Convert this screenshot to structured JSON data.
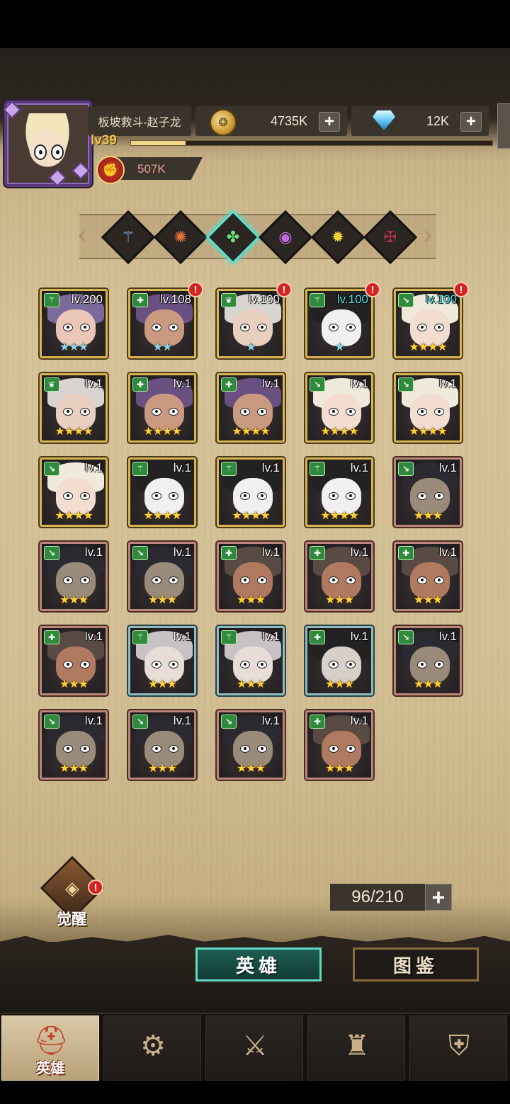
{
  "player": {
    "name": "板坡救斗-赵子龙",
    "level": "lv39",
    "level_progress": 0.15,
    "power": "507K"
  },
  "resources": {
    "gold": "4735K",
    "gems": "12K",
    "plus": "+"
  },
  "factions": [
    {
      "icon": "staff-faction-icon",
      "glyph": "⚚",
      "color": "#8fb8f0"
    },
    {
      "icon": "sun-faction-icon",
      "glyph": "✺",
      "color": "#e8743c"
    },
    {
      "icon": "clover-faction-icon",
      "glyph": "✤",
      "color": "#6be07a",
      "selected": true
    },
    {
      "icon": "eye-faction-icon",
      "glyph": "◉",
      "color": "#c66ae0"
    },
    {
      "icon": "radiant-faction-icon",
      "glyph": "✹",
      "color": "#f4d13a"
    },
    {
      "icon": "dark-faction-icon",
      "glyph": "✠",
      "color": "#b0304a"
    }
  ],
  "heroes": [
    {
      "level": "lv.200",
      "stars": "★★★",
      "star_color": "blue",
      "rarity": "legend",
      "cls": "⚚",
      "alert": false,
      "skin": "#e9c6b8",
      "hair": "#7b6a9a"
    },
    {
      "level": "lv.108",
      "stars": "★★",
      "star_color": "blue",
      "rarity": "legend",
      "cls": "✚",
      "alert": true,
      "skin": "#c99a80",
      "hair": "#6a5080"
    },
    {
      "level": "lv.100",
      "stars": "★",
      "star_color": "blue",
      "rarity": "legend",
      "cls": "❦",
      "alert": true,
      "skin": "#e8cfc0",
      "hair": "#d8d4d0"
    },
    {
      "level": "lv.100",
      "stars": "★",
      "star_color": "blue",
      "rarity": "legend",
      "cls": "⚚",
      "alert": true,
      "skin": "#f0f0f0",
      "hair": "#222",
      "level_color": "cyan"
    },
    {
      "level": "lv.100",
      "stars": "★★★★",
      "star_color": "gold",
      "rarity": "legend",
      "cls": "↘",
      "alert": true,
      "skin": "#f2ddd0",
      "hair": "#f0eadd",
      "level_color": "cyan"
    },
    {
      "level": "lv.1",
      "stars": "★★★★",
      "star_color": "gold",
      "rarity": "legend",
      "cls": "❦",
      "alert": false,
      "skin": "#e8cfc0",
      "hair": "#d8d4d0"
    },
    {
      "level": "lv.1",
      "stars": "★★★★",
      "star_color": "gold",
      "rarity": "legend",
      "cls": "✚",
      "alert": false,
      "skin": "#c99a80",
      "hair": "#6a5080"
    },
    {
      "level": "lv.1",
      "stars": "★★★★",
      "star_color": "gold",
      "rarity": "legend",
      "cls": "✚",
      "alert": false,
      "skin": "#c99a80",
      "hair": "#6a5080"
    },
    {
      "level": "lv.1",
      "stars": "★★★★",
      "star_color": "gold",
      "rarity": "legend",
      "cls": "↘",
      "alert": false,
      "skin": "#f2ddd0",
      "hair": "#f0eadd"
    },
    {
      "level": "lv.1",
      "stars": "★★★★",
      "star_color": "gold",
      "rarity": "legend",
      "cls": "↘",
      "alert": false,
      "skin": "#f2ddd0",
      "hair": "#f0eadd"
    },
    {
      "level": "lv.1",
      "stars": "★★★★",
      "star_color": "gold",
      "rarity": "legend",
      "cls": "↘",
      "alert": false,
      "skin": "#f2ddd0",
      "hair": "#f0eadd"
    },
    {
      "level": "lv.1",
      "stars": "★★★★",
      "star_color": "gold",
      "rarity": "legend",
      "cls": "⚚",
      "alert": false,
      "skin": "#f0f0f0",
      "hair": "#222"
    },
    {
      "level": "lv.1",
      "stars": "★★★★",
      "star_color": "gold",
      "rarity": "legend",
      "cls": "⚚",
      "alert": false,
      "skin": "#f0f0f0",
      "hair": "#222"
    },
    {
      "level": "lv.1",
      "stars": "★★★★",
      "star_color": "gold",
      "rarity": "legend",
      "cls": "⚚",
      "alert": false,
      "skin": "#f0f0f0",
      "hair": "#222"
    },
    {
      "level": "lv.1",
      "stars": "★★★",
      "star_color": "gold",
      "rarity": "rare",
      "cls": "↘",
      "alert": false,
      "skin": "#9a8a7a",
      "hair": "#2a2a30"
    },
    {
      "level": "lv.1",
      "stars": "★★★",
      "star_color": "gold",
      "rarity": "rare",
      "cls": "↘",
      "alert": false,
      "skin": "#9a8a7a",
      "hair": "#2a2a30"
    },
    {
      "level": "lv.1",
      "stars": "★★★",
      "star_color": "gold",
      "rarity": "rare",
      "cls": "↘",
      "alert": false,
      "skin": "#9a8a7a",
      "hair": "#2a2a30"
    },
    {
      "level": "lv.1",
      "stars": "★★★",
      "star_color": "gold",
      "rarity": "rare",
      "cls": "✚",
      "alert": false,
      "skin": "#b07a60",
      "hair": "#5a4a44"
    },
    {
      "level": "lv.1",
      "stars": "★★★",
      "star_color": "gold",
      "rarity": "rare",
      "cls": "✚",
      "alert": false,
      "skin": "#b07a60",
      "hair": "#5a4a44"
    },
    {
      "level": "lv.1",
      "stars": "★★★",
      "star_color": "gold",
      "rarity": "rare",
      "cls": "✚",
      "alert": false,
      "skin": "#b07a60",
      "hair": "#5a4a44"
    },
    {
      "level": "lv.1",
      "stars": "★★★",
      "star_color": "gold",
      "rarity": "rare",
      "cls": "✚",
      "alert": false,
      "skin": "#b07a60",
      "hair": "#5a4a44"
    },
    {
      "level": "lv.1",
      "stars": "★★★",
      "star_color": "gold",
      "rarity": "elite",
      "cls": "⚚",
      "alert": false,
      "skin": "#e8dcd6",
      "hair": "#c8c2c4"
    },
    {
      "level": "lv.1",
      "stars": "★★★",
      "star_color": "gold",
      "rarity": "elite",
      "cls": "⚚",
      "alert": false,
      "skin": "#e8dcd6",
      "hair": "#c8c2c4"
    },
    {
      "level": "lv.1",
      "stars": "★★★",
      "star_color": "gold",
      "rarity": "elite",
      "cls": "✚",
      "alert": false,
      "skin": "#d8cfc8",
      "hair": "#222"
    },
    {
      "level": "lv.1",
      "stars": "★★★",
      "star_color": "gold",
      "rarity": "rare",
      "cls": "↘",
      "alert": false,
      "skin": "#9a8a7a",
      "hair": "#2a2a30"
    },
    {
      "level": "lv.1",
      "stars": "★★★",
      "star_color": "gold",
      "rarity": "rare",
      "cls": "↘",
      "alert": false,
      "skin": "#9a8a7a",
      "hair": "#2a2a30"
    },
    {
      "level": "lv.1",
      "stars": "★★★",
      "star_color": "gold",
      "rarity": "rare",
      "cls": "↘",
      "alert": false,
      "skin": "#9a8a7a",
      "hair": "#2a2a30"
    },
    {
      "level": "lv.1",
      "stars": "★★★",
      "star_color": "gold",
      "rarity": "rare",
      "cls": "↘",
      "alert": false,
      "skin": "#9a8a7a",
      "hair": "#2a2a30"
    },
    {
      "level": "lv.1",
      "stars": "★★★",
      "star_color": "gold",
      "rarity": "rare",
      "cls": "✚",
      "alert": false,
      "skin": "#b07a60",
      "hair": "#5a4a44"
    }
  ],
  "awaken": {
    "label": "觉醒",
    "alert": "!"
  },
  "capacity": {
    "text": "96/210",
    "plus": "+"
  },
  "segment_tabs": {
    "heroes": "英雄",
    "codex": "图鉴"
  },
  "bottom_nav": [
    {
      "icon": "helmet-icon",
      "glyph": "⛑",
      "label": "英雄",
      "active": true
    },
    {
      "icon": "wheel-banner-icon",
      "glyph": "⚙",
      "label": "",
      "active": false
    },
    {
      "icon": "crossed-swords-icon",
      "glyph": "⚔",
      "label": "",
      "active": false
    },
    {
      "icon": "castle-tower-icon",
      "glyph": "♜",
      "label": "",
      "active": false
    },
    {
      "icon": "guild-shield-icon",
      "glyph": "⛨",
      "label": "",
      "active": false
    }
  ],
  "colors": {
    "legend_border": "#d7b452",
    "rare_border": "#b88676",
    "elite_border": "#8dbbc0",
    "active_tab": "#64d9c1",
    "alert": "#d7231d"
  }
}
